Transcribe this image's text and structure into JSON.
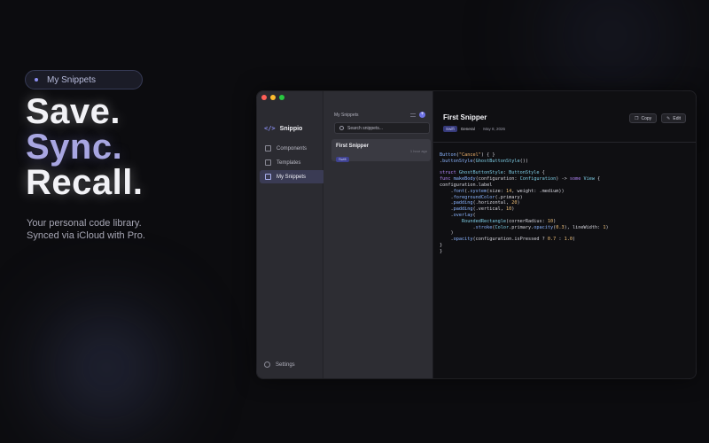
{
  "hero": {
    "pill_label": "My Snippets",
    "line1": "Save.",
    "line2": "Sync.",
    "line3": "Recall.",
    "tagline_line1": "Your personal code library.",
    "tagline_line2": "Synced via iCloud with Pro."
  },
  "app": {
    "brand_logo": "</>",
    "brand_name": "Snippio",
    "nav": [
      {
        "label": "Components",
        "icon": "grid-icon"
      },
      {
        "label": "Templates",
        "icon": "template-icon"
      },
      {
        "label": "My Snippets",
        "icon": "bookmark-icon",
        "active": true
      }
    ],
    "settings_label": "Settings",
    "list": {
      "header": "My Snippets",
      "add_symbol": "+",
      "search_placeholder": "Search snippets...",
      "items": [
        {
          "title": "First Snipper",
          "badge": "Swift",
          "time": "1 hour ago"
        }
      ]
    },
    "detail": {
      "title": "First Snipper",
      "tag": "Swift",
      "category": "General",
      "separator": "·",
      "date": "May 8, 2026",
      "copy_label": "Copy",
      "edit_label": "Edit"
    }
  },
  "colors": {
    "accent": "#6f73e6",
    "hero_accent": "#a8a6e2",
    "background": "#0c0c0f"
  }
}
